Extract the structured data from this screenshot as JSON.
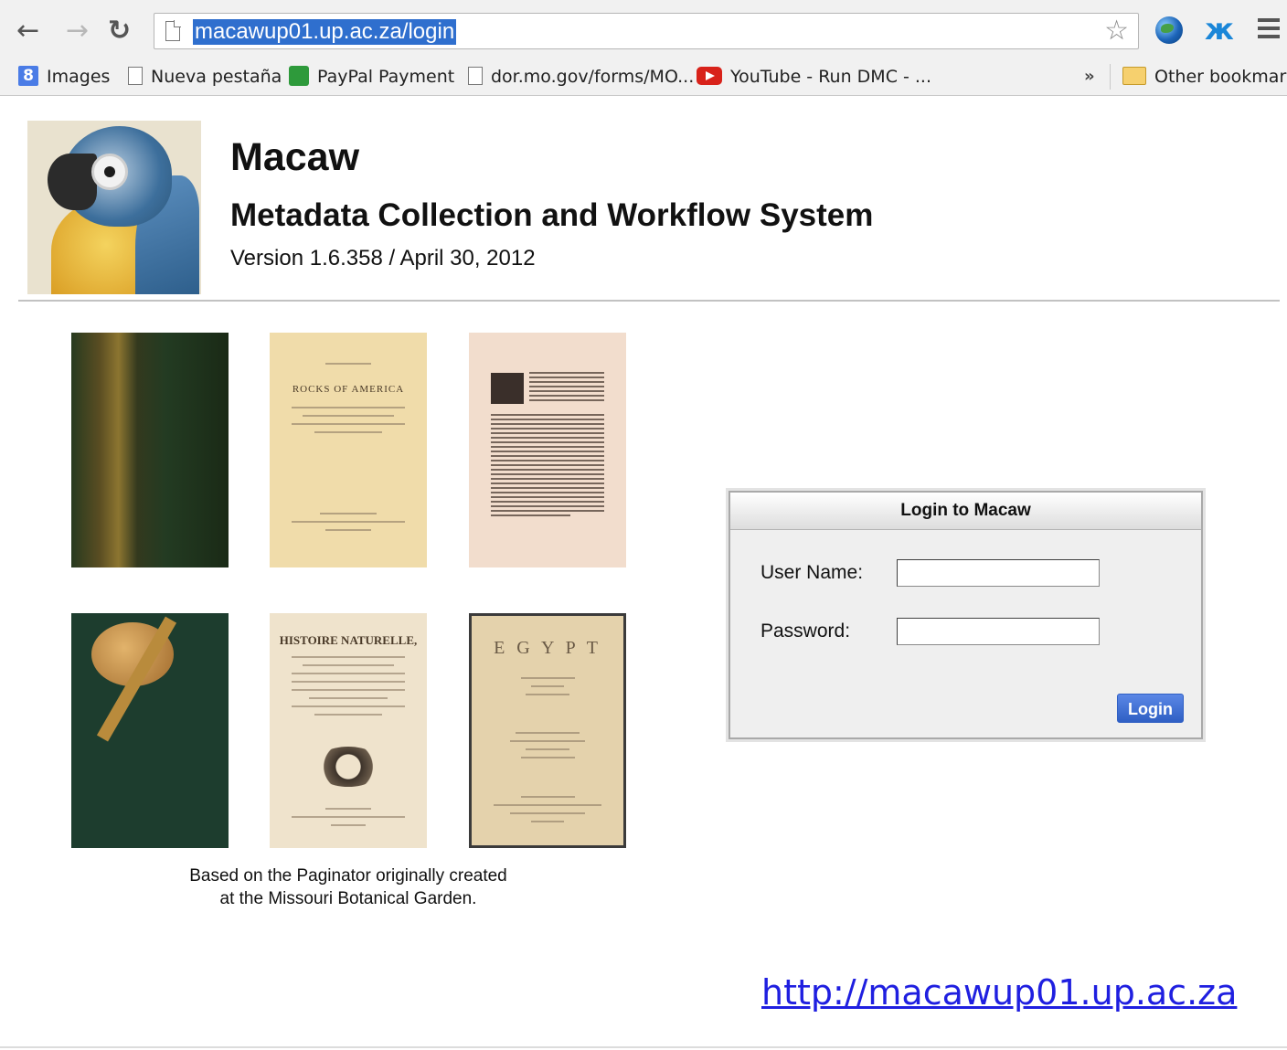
{
  "browser": {
    "url": "macawup01.up.ac.za/login",
    "bookmarks": [
      {
        "label": "Images",
        "icon": "google-icon"
      },
      {
        "label": "Nueva pestaña",
        "icon": "page-icon"
      },
      {
        "label": "PayPal Payment",
        "icon": "paypal-icon"
      },
      {
        "label": "dor.mo.gov/forms/MO...",
        "icon": "page-icon"
      },
      {
        "label": "YouTube - Run DMC - ...",
        "icon": "youtube-icon"
      }
    ],
    "overflow": "»",
    "other_bookmarks": "Other bookmarks"
  },
  "header": {
    "title": "Macaw",
    "subtitle": "Metadata Collection and Workflow System",
    "version": "Version 1.6.358 / April 30, 2012"
  },
  "gallery": {
    "caption_line1": "Based on the Paginator originally created",
    "caption_line2": "at the Missouri Botanical Garden.",
    "book_texts": {
      "rocks": "ROCKS OF AMERICA",
      "histoire": "HISTOIRE NATURELLE,",
      "egypt": "E G Y P T"
    }
  },
  "login": {
    "title": "Login to Macaw",
    "username_label": "User Name:",
    "password_label": "Password:",
    "username_value": "",
    "password_value": "",
    "button": "Login",
    "accent": "#2f5fc4"
  },
  "footer": {
    "link": "http://macawup01.up.ac.za"
  }
}
